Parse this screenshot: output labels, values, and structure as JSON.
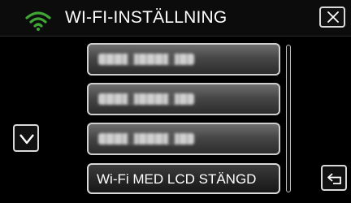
{
  "header": {
    "title": "WI-FI-INSTÄLLNING",
    "wifi_icon": "wifi-icon",
    "close_icon": "close-icon",
    "accent_color": "#3fa535"
  },
  "list": {
    "items": [
      {
        "label": "",
        "obscured": true
      },
      {
        "label": "",
        "obscured": true
      },
      {
        "label": "",
        "obscured": true
      },
      {
        "label": "Wi-Fi MED LCD STÄNGD"
      }
    ]
  },
  "controls": {
    "scroll_down_icon": "chevron-down-icon",
    "back_icon": "return-icon"
  }
}
